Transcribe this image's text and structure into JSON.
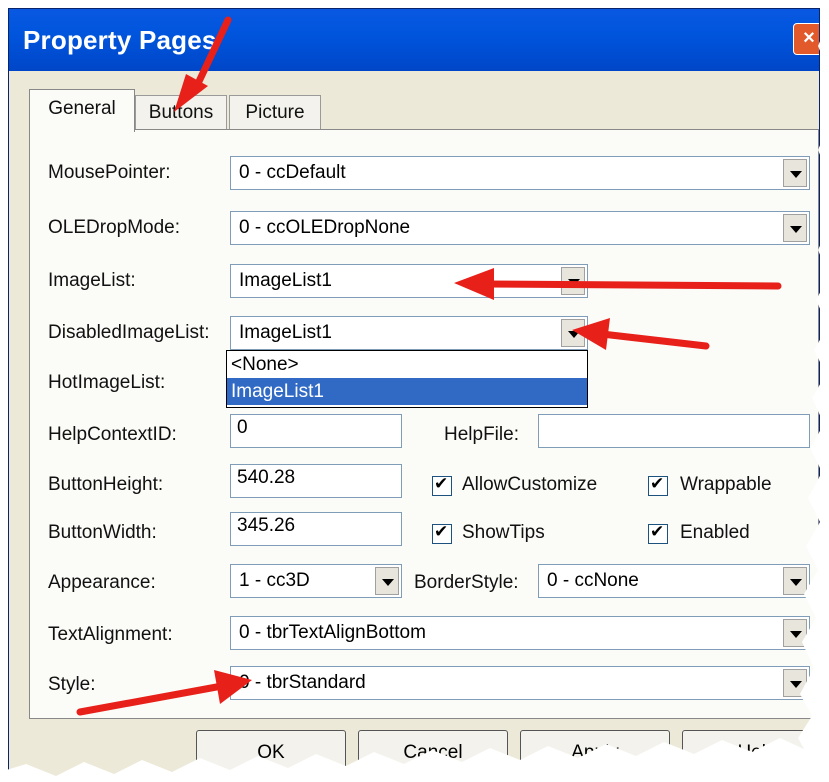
{
  "window": {
    "title": "Property Pages",
    "close_glyph": "×"
  },
  "tabs": [
    {
      "label": "General",
      "active": true
    },
    {
      "label": "Buttons",
      "active": false
    },
    {
      "label": "Picture",
      "active": false
    }
  ],
  "fields": {
    "mouse_pointer": {
      "label": "MousePointer:",
      "value": "0 - ccDefault"
    },
    "ole_drop_mode": {
      "label": "OLEDropMode:",
      "value": "0 - ccOLEDropNone"
    },
    "image_list": {
      "label": "ImageList:",
      "value": "ImageList1"
    },
    "disabled_image_list": {
      "label": "DisabledImageList:",
      "value": "ImageList1"
    },
    "hot_image_list": {
      "label": "HotImageList:"
    },
    "help_context_id": {
      "label": "HelpContextID:",
      "value": "0"
    },
    "help_file": {
      "label": "HelpFile:",
      "value": ""
    },
    "button_height": {
      "label": "ButtonHeight:",
      "value": "540.28"
    },
    "button_width": {
      "label": "ButtonWidth:",
      "value": "345.26"
    },
    "appearance": {
      "label": "Appearance:",
      "value": "1 - cc3D"
    },
    "border_style": {
      "label": "BorderStyle:",
      "value": "0 - ccNone"
    },
    "text_alignment": {
      "label": "TextAlignment:",
      "value": "0 - tbrTextAlignBottom"
    },
    "style": {
      "label": "Style:",
      "value": "0 - tbrStandard"
    }
  },
  "dropdown_options": [
    "<None>",
    "ImageList1"
  ],
  "dropdown_selected": "ImageList1",
  "checkboxes": {
    "allow_customize": {
      "label": "AllowCustomize",
      "checked": true
    },
    "wrappable": {
      "label": "Wrappable",
      "checked": true
    },
    "show_tips": {
      "label": "ShowTips",
      "checked": true
    },
    "enabled": {
      "label": "Enabled",
      "checked": true
    }
  },
  "buttons": {
    "ok": "OK",
    "cancel": "Cancel",
    "apply": "Apply",
    "help": "Help"
  },
  "colors": {
    "titlebar": "#0055dd",
    "selection": "#316ac5",
    "annotation_arrow": "#e8201a",
    "dialog_face": "#ece9d8"
  }
}
